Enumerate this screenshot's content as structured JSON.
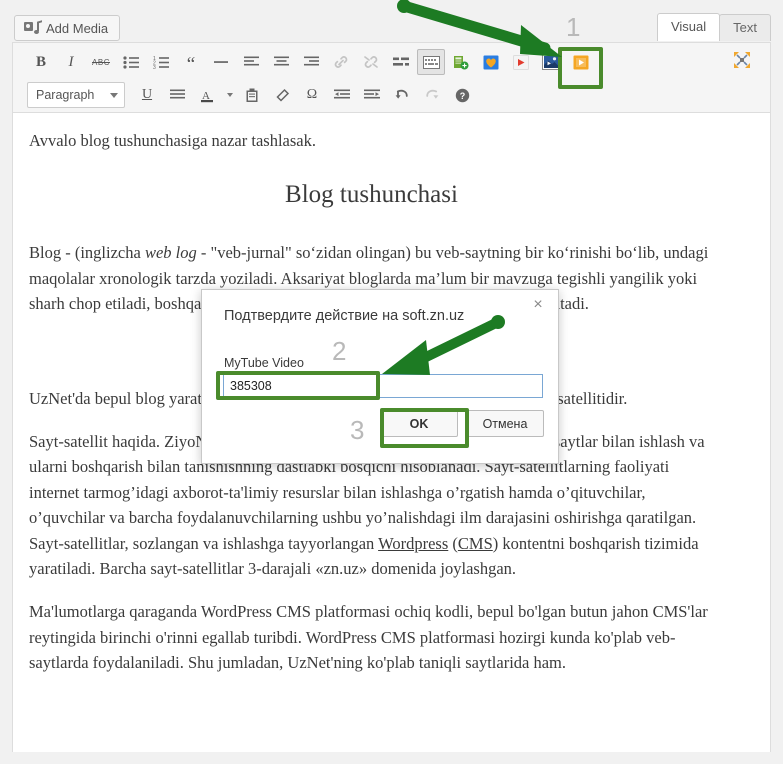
{
  "topbar": {
    "add_media_label": "Add Media",
    "tabs": [
      {
        "label": "Visual",
        "active": true
      },
      {
        "label": "Text",
        "active": false
      }
    ]
  },
  "toolbar": {
    "row1": [
      {
        "name": "bold",
        "glyph": "B",
        "state": "normal"
      },
      {
        "name": "italic",
        "glyph": "I",
        "state": "normal"
      },
      {
        "name": "strikethrough",
        "glyph": "ABC",
        "state": "normal"
      },
      {
        "name": "bulleted-list",
        "glyph": "",
        "state": "normal"
      },
      {
        "name": "numbered-list",
        "glyph": "",
        "state": "normal"
      },
      {
        "name": "blockquote",
        "glyph": "“",
        "state": "normal"
      },
      {
        "name": "horizontal-rule",
        "glyph": "—",
        "state": "normal"
      },
      {
        "name": "align-left",
        "glyph": "",
        "state": "normal"
      },
      {
        "name": "align-center",
        "glyph": "",
        "state": "normal"
      },
      {
        "name": "align-right",
        "glyph": "",
        "state": "normal"
      },
      {
        "name": "insert-link",
        "glyph": "",
        "state": "disabled"
      },
      {
        "name": "remove-link",
        "glyph": "",
        "state": "disabled"
      },
      {
        "name": "read-more-tag",
        "glyph": "",
        "state": "normal"
      },
      {
        "name": "toolbar-toggle",
        "glyph": "",
        "state": "pressed"
      },
      {
        "name": "insert-file",
        "glyph": "",
        "state": "normal"
      },
      {
        "name": "heart-plugin",
        "glyph": "",
        "state": "normal"
      },
      {
        "name": "video-plugin-red",
        "glyph": "",
        "state": "normal"
      },
      {
        "name": "mytube-video-plugin",
        "glyph": "",
        "state": "highlighted"
      },
      {
        "name": "video-plugin-orange",
        "glyph": "",
        "state": "normal"
      }
    ],
    "fullscreen_name": "distraction-free-writing",
    "row2_select_value": "Paragraph",
    "row2": [
      {
        "name": "underline",
        "glyph": "U",
        "state": "normal"
      },
      {
        "name": "justify",
        "glyph": "",
        "state": "normal"
      },
      {
        "name": "text-color",
        "glyph": "A",
        "state": "normal"
      },
      {
        "name": "paste-as-text",
        "glyph": "",
        "state": "normal"
      },
      {
        "name": "clear-formatting",
        "glyph": "",
        "state": "normal"
      },
      {
        "name": "special-character",
        "glyph": "Ω",
        "state": "normal"
      },
      {
        "name": "outdent",
        "glyph": "",
        "state": "normal"
      },
      {
        "name": "indent",
        "glyph": "",
        "state": "normal"
      },
      {
        "name": "undo",
        "glyph": "",
        "state": "normal"
      },
      {
        "name": "redo",
        "glyph": "",
        "state": "disabled"
      },
      {
        "name": "keyboard-shortcuts",
        "glyph": "?",
        "state": "normal"
      }
    ]
  },
  "document": {
    "intro": "Avvalo blog tushunchasiga nazar tashlasak.",
    "heading": "Blog tushunchasi",
    "para1_a": "Blog - (inglizcha ",
    "para1_em": "web log",
    "para1_b": " - \"veb-jurnal\" so‘zidan olingan) bu veb-saytning bir ko‘rinishi bo‘lib, undagi maqolalar xronologik tarzda yoziladi. Aksariyat bloglarda ma’lum bir mavzuga tegishli yangilik yoki sharh chop etiladi, boshqalari esa shaxsiy onlayn kundalik sifatida xizmat ko‘rsatadi.",
    "para2": "UzNet'da bepul blog yaratish imkonini beruvchi sayt ZiyoNET portalining sayt-satellitidir.",
    "para3_a": "Sayt-satellit haqida. ZiyoNET portalining sayt-satellitlari internet tarmog’idagi saytlar bilan ishlash va ularni boshqarish bilan tanishishning dastlabki bosqichi hisoblanadi. Sayt-satellitlarning faoliyati internet tarmog’idagi axborot-ta'limiy resurslar bilan ishlashga o’rgatish hamda o’qituvchilar, o’quvchilar va barcha foydalanuvchilarning ushbu yo’nalishdagi ilm darajasini oshirishga qaratilgan. Sayt-satellitlar, sozlangan va ishlashga tayyorlangan ",
    "para3_link1": "Wordpress",
    "para3_mid": " (",
    "para3_link2": "CMS",
    "para3_b": ") kontentni boshqarish tizimida yaratiladi. Barcha sayt-satellitlar 3-darajali «zn.uz» domenida joylashgan.",
    "para4": "Ma'lumotlarga qaraganda WordPress CMS platformasi ochiq kodli, bepul bo'lgan butun jahon CMS'lar reytingida birinchi o'rinni egallab turibdi.  WordPress CMS platformasi hozirgi kunda ko'plab veb-saytlarda foydalaniladi. Shu jumladan, UzNet'ning ko'plab taniqli saytlarida ham."
  },
  "dialog": {
    "title": "Подтвердите действие на soft.zn.uz",
    "close_glyph": "×",
    "field_label": "MyTube Video",
    "field_value": "385308",
    "ok_label": "OK",
    "cancel_label": "Отмена"
  },
  "annotations": {
    "numbers": [
      "1",
      "2",
      "3"
    ],
    "highlight_color": "#4a8b2c",
    "arrow_color": "#1d7b23"
  }
}
